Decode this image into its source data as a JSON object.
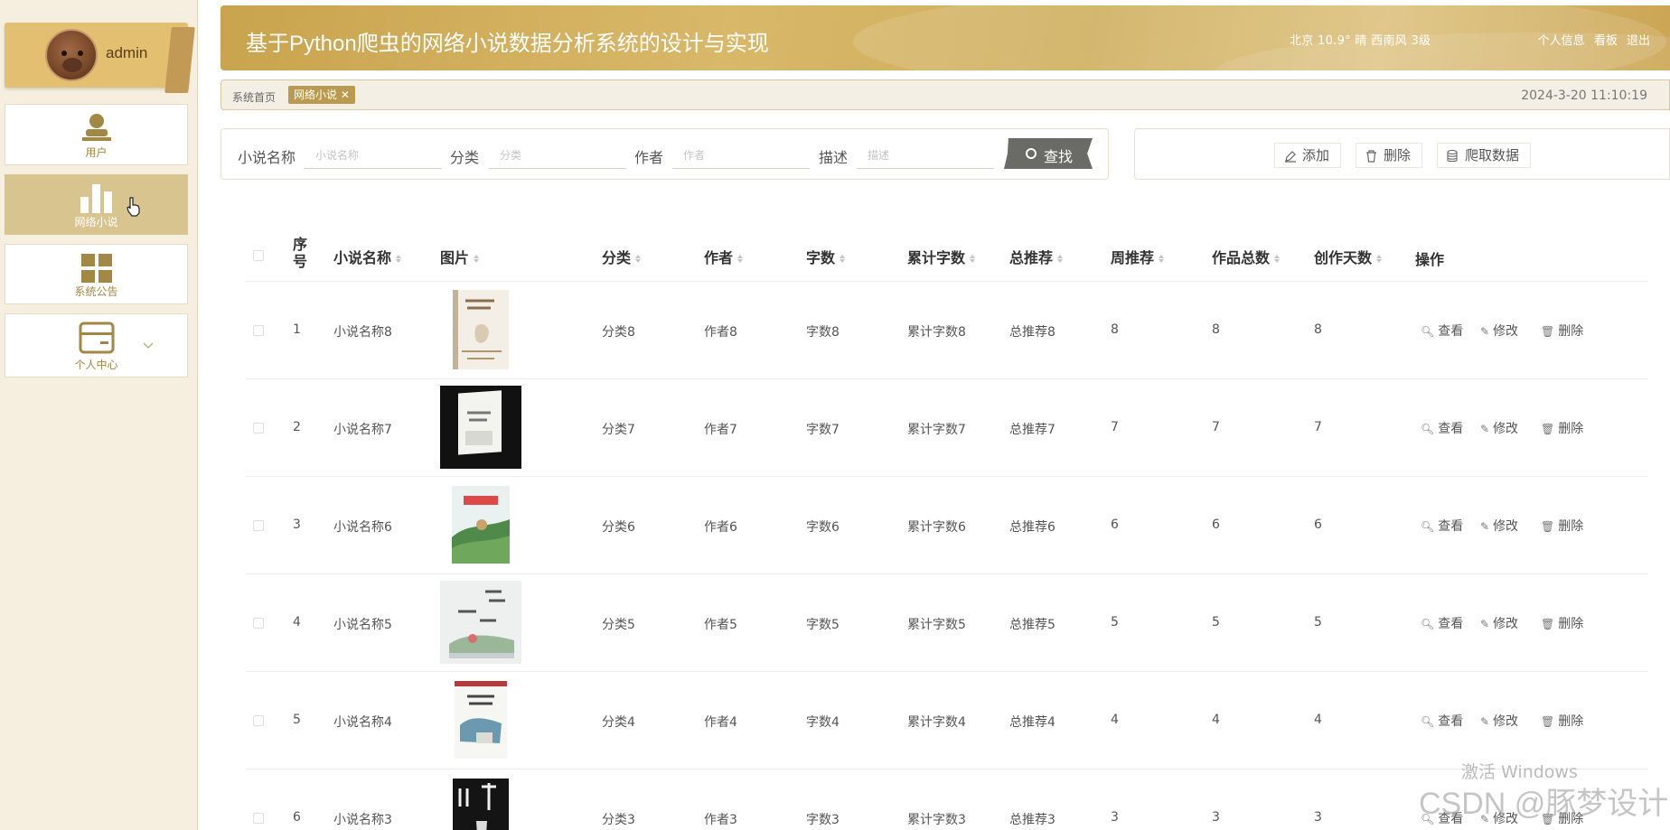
{
  "user": {
    "name": "admin"
  },
  "nav": [
    {
      "label": "用户",
      "icon": "user-icon"
    },
    {
      "label": "网络小说",
      "icon": "bar-chart-icon",
      "active": true
    },
    {
      "label": "系统公告",
      "icon": "grid-icon"
    },
    {
      "label": "个人中心",
      "icon": "card-icon"
    }
  ],
  "header": {
    "title": "基于Python爬虫的网络小说数据分析系统的设计与实现",
    "weather": "北京  10.9°  晴  西南风  3级",
    "links": [
      "个人信息",
      "看板",
      "退出"
    ]
  },
  "breadcrumb": {
    "home": "系统首页",
    "tag": "网络小说 ✕",
    "datetime": "2024-3-20 11:10:19"
  },
  "search": {
    "fields": [
      {
        "label": "小说名称",
        "placeholder": "小说名称"
      },
      {
        "label": "分类",
        "placeholder": "分类"
      },
      {
        "label": "作者",
        "placeholder": "作者"
      },
      {
        "label": "描述",
        "placeholder": "描述"
      }
    ],
    "button": "查找"
  },
  "actions": {
    "add": "添加",
    "delete": "删除",
    "crawl": "爬取数据"
  },
  "table": {
    "headers": {
      "index": "序号",
      "name": "小说名称",
      "image": "图片",
      "category": "分类",
      "author": "作者",
      "words": "字数",
      "total_words": "累计字数",
      "total_rec": "总推荐",
      "week_rec": "周推荐",
      "works": "作品总数",
      "days": "创作天数",
      "ops": "操作"
    },
    "ops": {
      "view": "查看",
      "edit": "修改",
      "delete": "删除"
    },
    "rows": [
      {
        "index": "1",
        "name": "小说名称8",
        "category": "分类8",
        "author": "作者8",
        "words": "字数8",
        "total_words": "累计字数8",
        "total_rec": "总推荐8",
        "week_rec": "8",
        "works": "8",
        "days": "8"
      },
      {
        "index": "2",
        "name": "小说名称7",
        "category": "分类7",
        "author": "作者7",
        "words": "字数7",
        "total_words": "累计字数7",
        "total_rec": "总推荐7",
        "week_rec": "7",
        "works": "7",
        "days": "7"
      },
      {
        "index": "3",
        "name": "小说名称6",
        "category": "分类6",
        "author": "作者6",
        "words": "字数6",
        "total_words": "累计字数6",
        "total_rec": "总推荐6",
        "week_rec": "6",
        "works": "6",
        "days": "6"
      },
      {
        "index": "4",
        "name": "小说名称5",
        "category": "分类5",
        "author": "作者5",
        "words": "字数5",
        "total_words": "累计字数5",
        "total_rec": "总推荐5",
        "week_rec": "5",
        "works": "5",
        "days": "5"
      },
      {
        "index": "5",
        "name": "小说名称4",
        "category": "分类4",
        "author": "作者4",
        "words": "字数4",
        "total_words": "累计字数4",
        "total_rec": "总推荐4",
        "week_rec": "4",
        "works": "4",
        "days": "4"
      },
      {
        "index": "6",
        "name": "小说名称3",
        "category": "分类3",
        "author": "作者3",
        "words": "字数3",
        "total_words": "累计字数3",
        "total_rec": "总推荐3",
        "week_rec": "3",
        "works": "3",
        "days": "3"
      }
    ]
  },
  "watermark": {
    "line1": "激活 Windows",
    "line2": "CSDN @豚梦设计"
  }
}
